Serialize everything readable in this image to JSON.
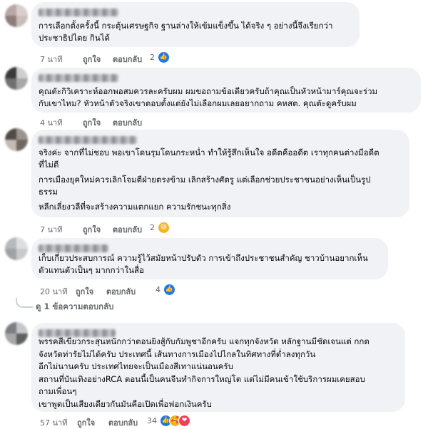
{
  "comments": [
    {
      "text": [
        "การเลือกตั้งครั้งนี้ กระตุ้นเศรษฐกิจ ฐานล่างให้เข้มแข็งขึ้น ได้จริง ๆ อย่างนี้จึงเรียกว่า",
        "ประชาธิปไตย กินได้"
      ],
      "time": "7 นาที",
      "like_label": "ถูกใจ",
      "reply_label": "ตอบกลับ",
      "reaction_count": "2",
      "reactions": [
        "like"
      ]
    },
    {
      "text": [
        "คุณตัะกิวิเคราะห์ออกพอสมควรละครับผม ผมขอถามข้อเดียวครับถ้าคุณเป็นหัวหน้ามาร์คุณจะร่วม",
        "กับเขาไหม? หัวหน้าตัวจริงเขาตอบตั้งแต่ยังไม่เลือกผมเลยอยากถาม คหสต. คุณตัะดูครับผม"
      ],
      "time": "4 นาที",
      "like_label": "ถูกใจ",
      "reply_label": "ตอบกลับ",
      "reaction_count": "",
      "reactions": []
    },
    {
      "paragraphs": [
        [
          "จริงค่ะ จากที่ไม่ชอบ พอเขาโดนรุมโดนกระหน่ำ ทำให้รู้สึกเห็นใจ อดีตคืออดีต เราทุกคนต่างมีอดีต",
          "ที่ไม่ดี"
        ],
        [
          "การเมืองยุคใหม่ควรเลิกโจมตีฝ่ายตรงข้าม เลิกสร้างศัตรู แต่เลือกช่วยประชาชนอย่างเห็นเป็นรูป",
          "ธรรม"
        ],
        [
          "หลีกเลี่ยงวลีที่จะสร้างความแตกแยก ความรักชนะทุกสิ่ง"
        ]
      ],
      "time": "7 นาที",
      "like_label": "ถูกใจ",
      "reply_label": "ตอบกลับ",
      "reaction_count": "2",
      "reactions": [
        "haha"
      ]
    },
    {
      "text": [
        "เก็บเกี่ยวประสบการณ์ ความรู้ไว้สมัยหน้าปรับตัว การเข้าถึงประชาชนสำคัญ ชาวบ้านอยากเห็น",
        "ตัวแทนตัวเป็นๆ มากกว่าในสื่อ"
      ],
      "time": "20 นาที",
      "like_label": "ถูกใจ",
      "reply_label": "ตอบกลับ",
      "reaction_count": "4",
      "reactions": [
        "like"
      ],
      "view_replies": "ดู 1 ข้อความตอบกลับ"
    },
    {
      "text": [
        "พรรคสีเขียวกระสุนหนักกว่าตอนยิงสู้กับกัมพูชาอีกครับ แจกทุกจังหวัด หลักฐานมีชัดเจนแต่ กกต",
        "จังหวัดท่ารัยไม่ได้ครับ ประเทศนี้ เส้นทางการเมืองไปไกลในทิศทางที่ต่ำลงทุกวัน",
        "อีกไม่นานครับ ประเทศไทยจะเป็นเมืองสีเทาแน่นอนครับ",
        "สถานที่บันเทิงอย่างRCA ตอนนี้เป็นคนจีนทำกิจการใหญ่โต แต่ไม่มีคนเข้าใช้บริการผมเคยสอบ",
        "ถามเพื่อนๆ",
        "เขาพูดเป็นเสียงเดียวกันมันคือเปิดเพื่อฟอกเงินครับ"
      ],
      "time": "57 นาที",
      "like_label": "ถูกใจ",
      "reply_label": "ตอบกลับ",
      "reaction_count": "34",
      "reactions": [
        "like",
        "care",
        "love"
      ]
    }
  ]
}
